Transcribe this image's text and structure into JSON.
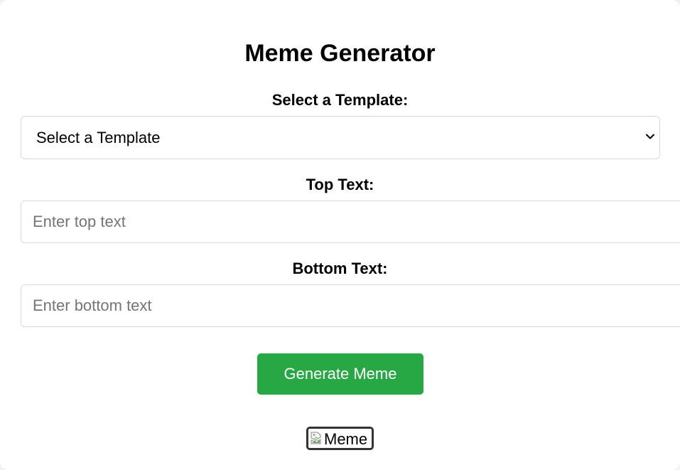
{
  "page": {
    "title": "Meme Generator"
  },
  "template_field": {
    "label": "Select a Template:",
    "selected_value": "Select a Template",
    "icon": "chevron-down-icon"
  },
  "top_text_field": {
    "label": "Top Text:",
    "value": "",
    "placeholder": "Enter top text"
  },
  "bottom_text_field": {
    "label": "Bottom Text:",
    "value": "",
    "placeholder": "Enter bottom text"
  },
  "generate_button": {
    "label": "Generate Meme"
  },
  "meme_image": {
    "alt": "Meme",
    "icon": "broken-image-icon"
  },
  "colors": {
    "button_background": "#28a745",
    "button_text": "#ffffff",
    "card_background": "#ffffff",
    "input_border": "#d9d9d9",
    "image_border": "#333333"
  }
}
